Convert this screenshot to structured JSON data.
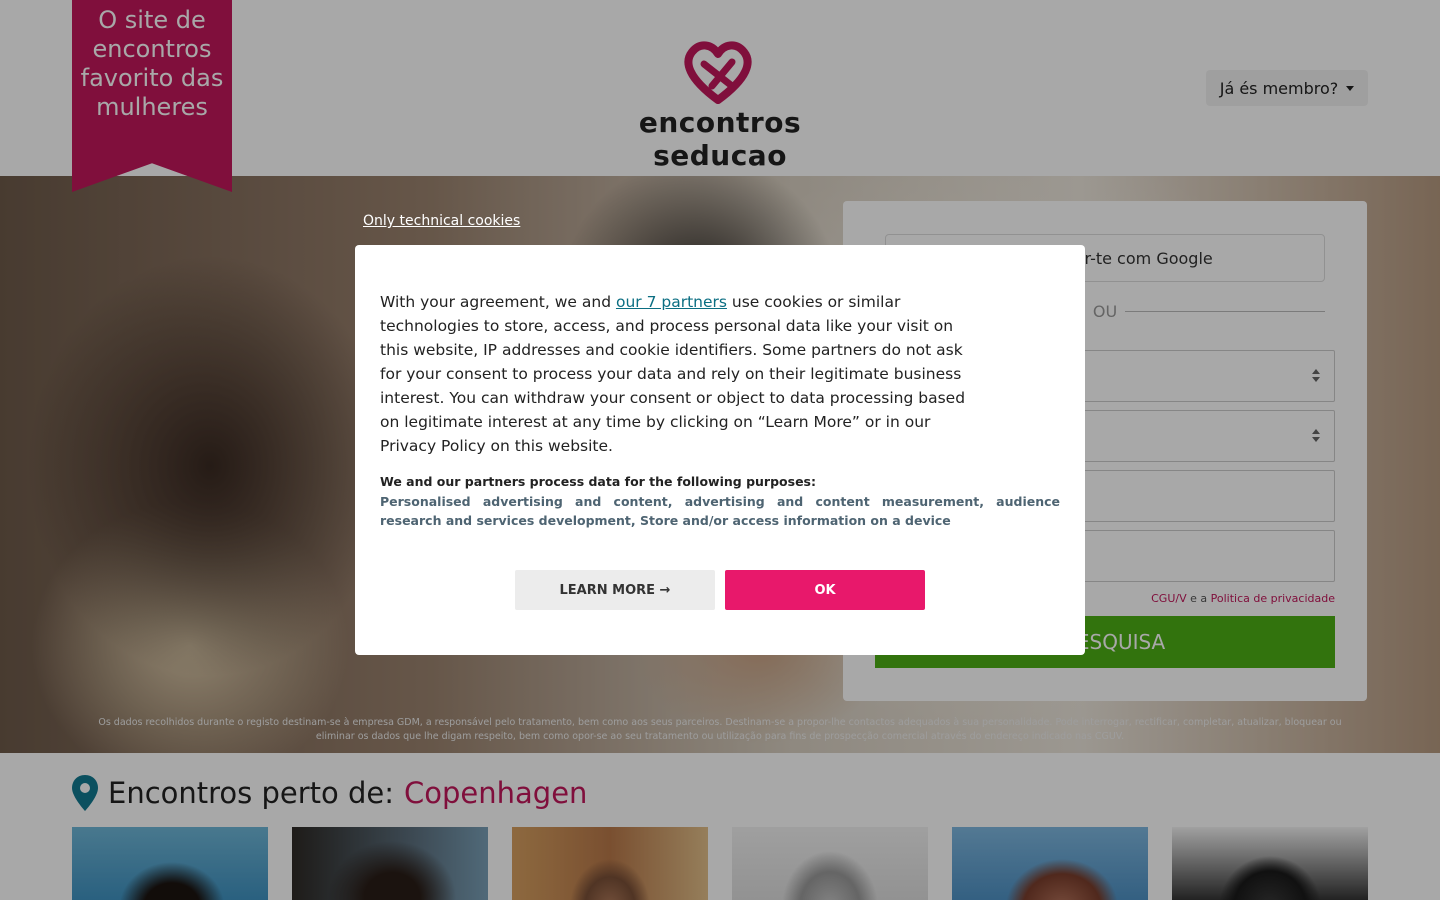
{
  "header": {
    "ribbon_text": "O site de encontros favorito das mulheres",
    "logo_text": "encontros seducao",
    "member_button": "Já és membro?"
  },
  "signup": {
    "google_button": "Registar-te com Google",
    "or_label": "OU",
    "terms_link": "CGU/V",
    "terms_and": "e a",
    "privacy_link": "Politica de privacidade",
    "search_button": "A PESQUISA"
  },
  "legal_text": "Os dados recolhidos durante o registo destinam-se à empresa GDM, a responsável pelo tratamento, bem como aos seus parceiros. Destinam-se a propor-lhe contactos adequados à sua personalidade. Pode interrogar, rectificar, completar, atualizar, bloquear ou eliminar os dados que lhe digam respeito, bem como opor-se ao seu tratamento ou utilização para fins de prospecção comercial através do endereço indicado nas CGUV.",
  "nearby": {
    "label": "Encontros perto de:",
    "city": "Copenhagen"
  },
  "cookie_modal": {
    "technical_link": "Only technical cookies",
    "intro_before": "With your agreement, we and ",
    "partners_link": "our 7 partners",
    "intro_after": " use cookies or similar technologies to store, access, and process personal data like your visit on this website, IP addresses and cookie identifiers. Some partners do not ask for your consent to process your data and rely on their legitimate business interest. You can withdraw your consent or object to data processing based on legitimate interest at any time by clicking on “Learn More” or in our Privacy Policy on this website.",
    "purposes_heading": "We and our partners process data for the following purposes:",
    "purposes_list": "Personalised advertising and content, advertising and content measurement, audience research and services development, Store and/or access information on a device",
    "learn_more_button": "LEARN MORE →",
    "ok_button": "OK"
  },
  "colors": {
    "brand": "#c2185b",
    "search_button": "#4caf14",
    "ok_button": "#e8186b",
    "partners_link": "#0b6e82"
  },
  "icons": [
    "heart-logo-icon",
    "location-pin-icon",
    "google-icon",
    "dropdown-caret-icon",
    "select-arrows-icon"
  ]
}
